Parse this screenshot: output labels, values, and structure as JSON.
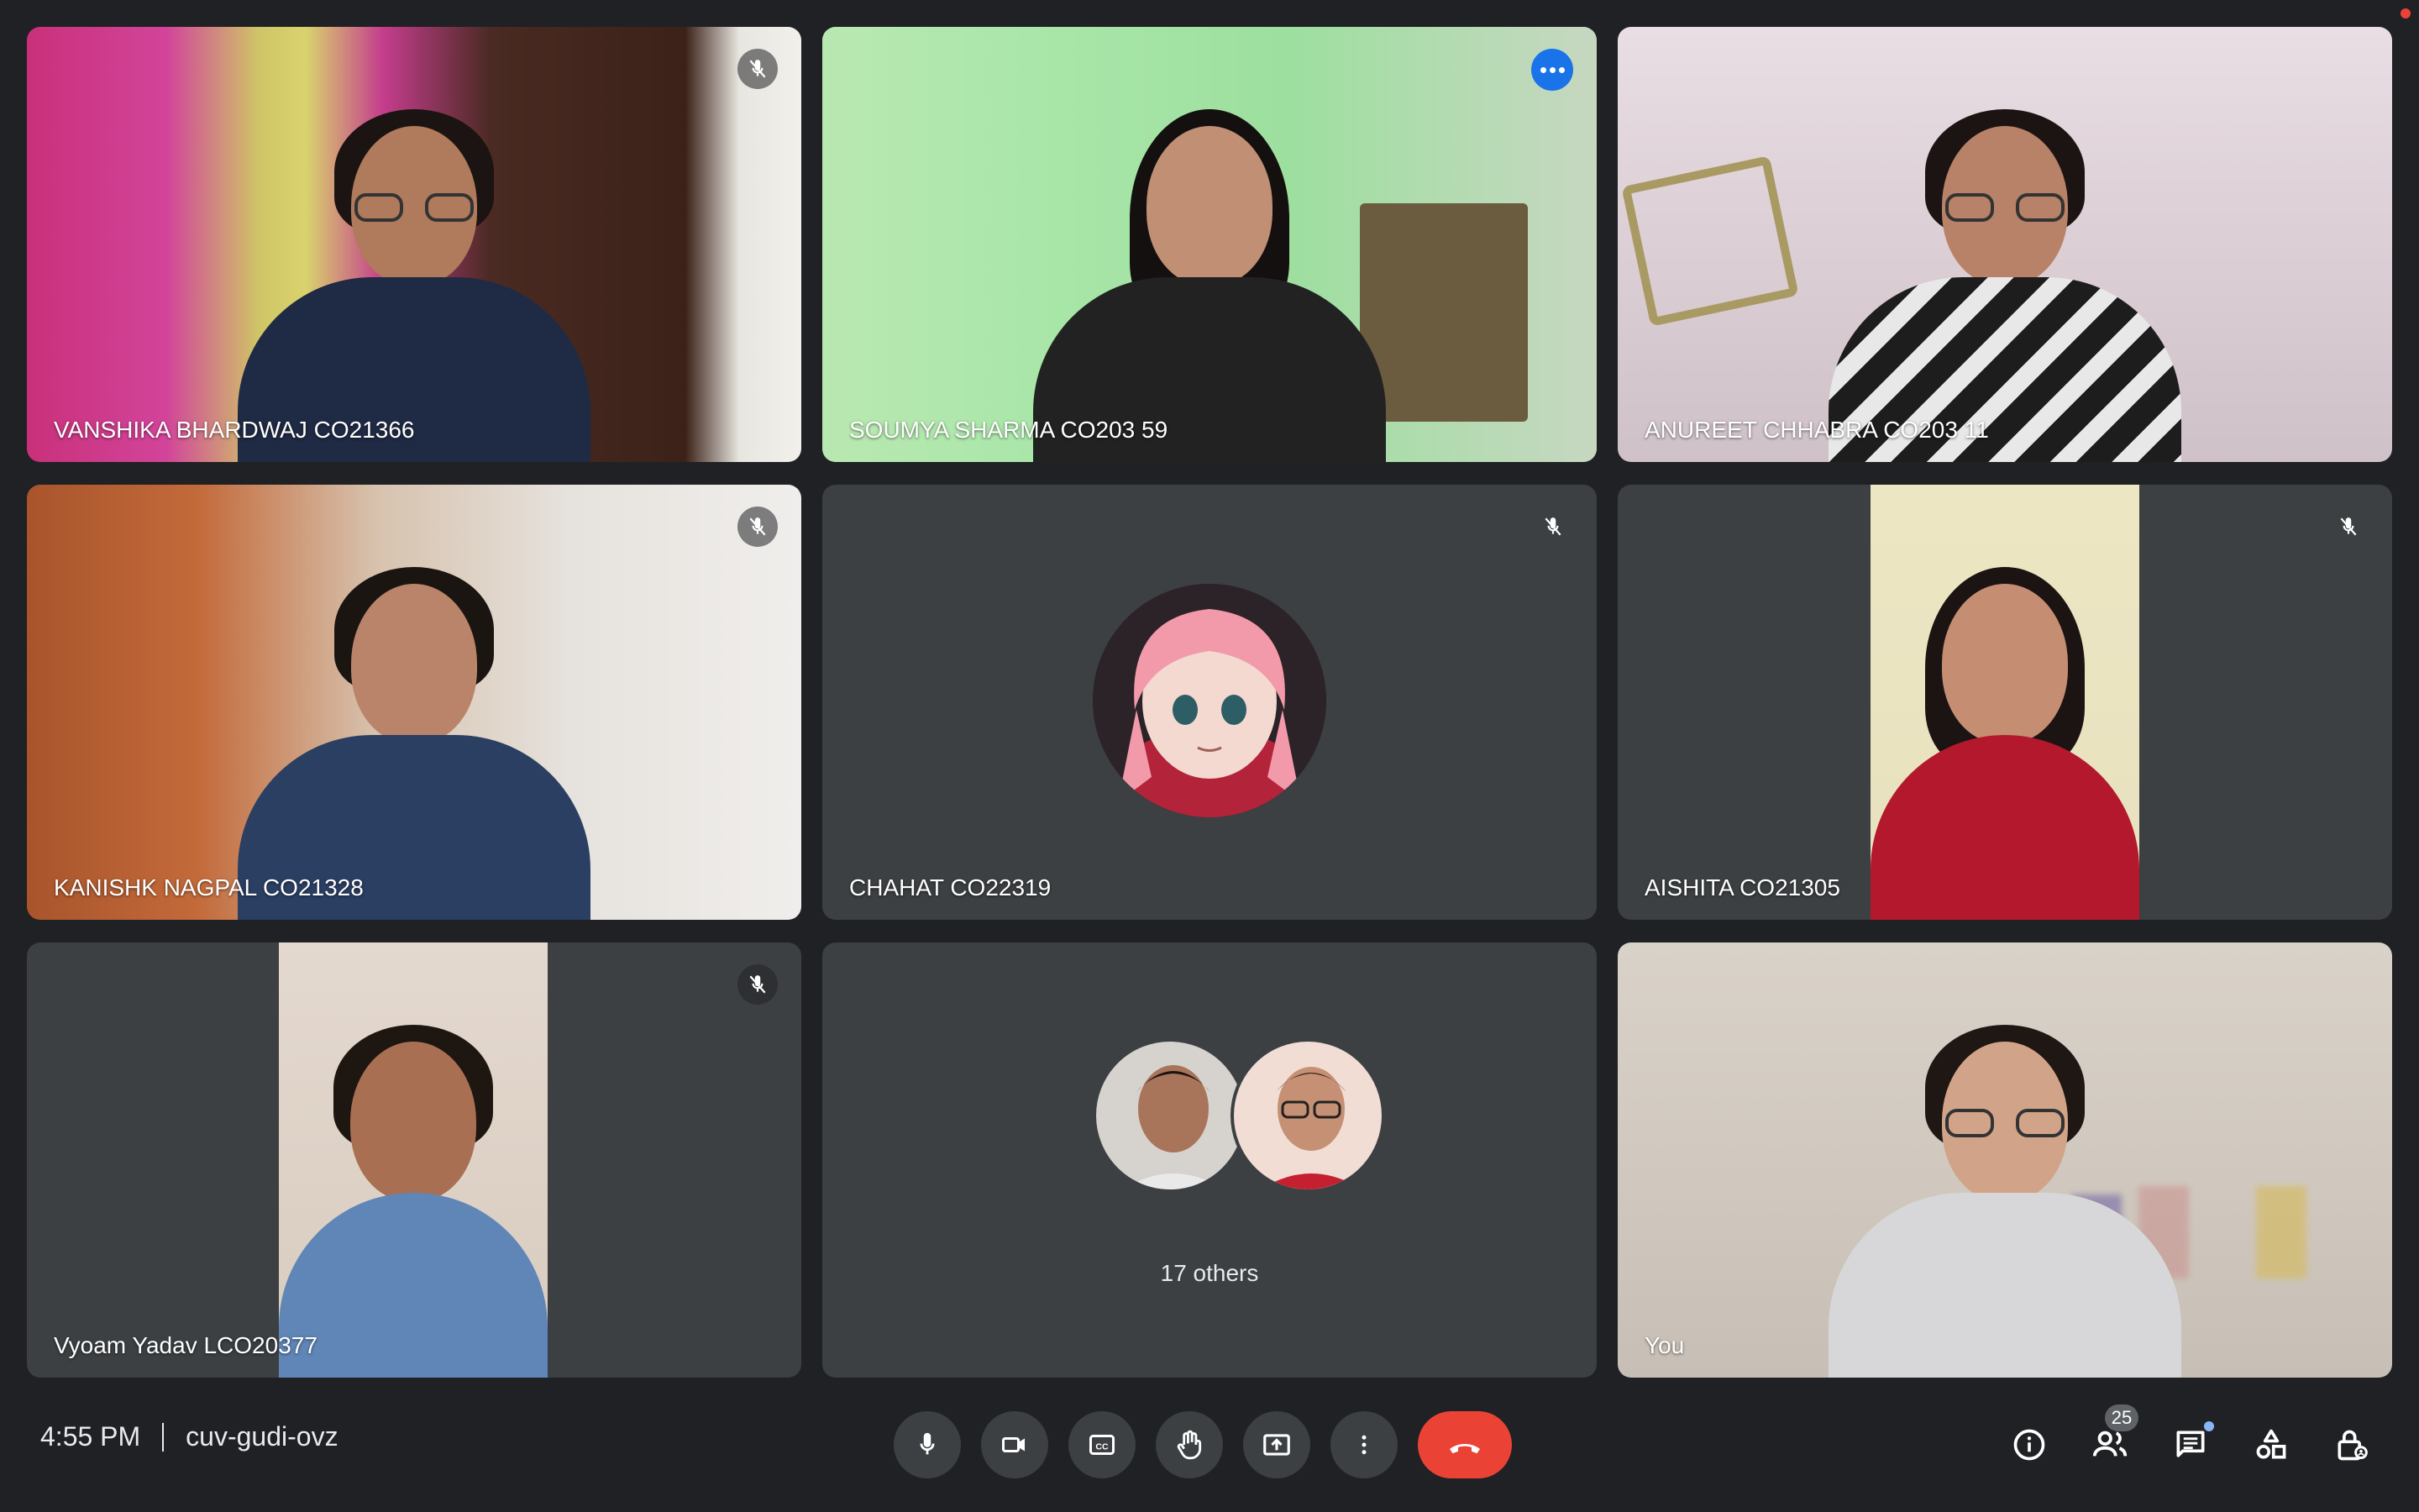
{
  "participants": [
    {
      "name": "VANSHIKA BHARDWAJ CO21366",
      "muted": true
    },
    {
      "name": "SOUMYA SHARMA CO203 59",
      "active_speaker": true
    },
    {
      "name": "ANUREET CHHABRA CO203 11"
    },
    {
      "name": "KANISHK NAGPAL CO21328",
      "muted": true
    },
    {
      "name": "CHAHAT CO22319",
      "muted": true,
      "camera_off": true
    },
    {
      "name": "AISHITA CO21305",
      "muted": true
    },
    {
      "name": "Vyoam Yadav LCO20377",
      "muted": true
    },
    {
      "others_label": "17 others"
    },
    {
      "name": "You"
    }
  ],
  "meeting": {
    "time": "4:55 PM",
    "code": "cuv-gudi-ovz"
  },
  "people_count": "25",
  "icons": {
    "mic": "mic-icon",
    "camera": "camera-icon",
    "captions": "captions-icon",
    "raise_hand": "raise-hand-icon",
    "present": "present-screen-icon",
    "more": "more-options-icon",
    "end_call": "end-call-icon",
    "info": "info-icon",
    "people": "people-icon",
    "chat": "chat-icon",
    "activities": "activities-icon",
    "host_controls": "host-controls-icon",
    "muted": "mic-off-icon"
  },
  "colors": {
    "background": "#202124",
    "tile": "#3c4043",
    "active_border": "#8ab4f8",
    "end_call": "#ea4335",
    "accent": "#1a73e8"
  }
}
